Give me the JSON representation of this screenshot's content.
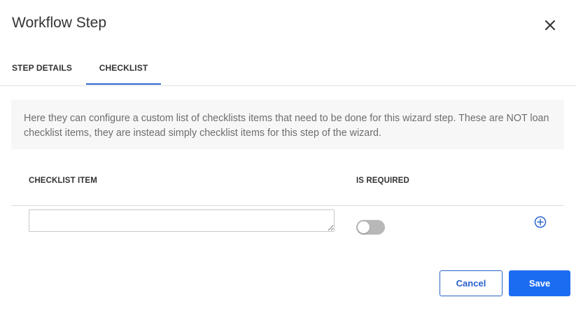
{
  "dialog": {
    "title": "Workflow Step"
  },
  "tabs": [
    {
      "label": "STEP DETAILS",
      "active": false
    },
    {
      "label": "CHECKLIST",
      "active": true
    }
  ],
  "info": {
    "text": "Here they can configure a custom list of checklists items that need to be done for this wizard step. These are NOT loan checklist items, they are instead simply checklist items for this step of the wizard."
  },
  "table": {
    "headers": {
      "item": "CHECKLIST ITEM",
      "required": "IS REQUIRED"
    },
    "rows": [
      {
        "item_value": "",
        "is_required": false
      }
    ]
  },
  "footer": {
    "cancel_label": "Cancel",
    "save_label": "Save"
  },
  "icons": {
    "close": "close-icon",
    "add": "plus-circle-icon"
  },
  "colors": {
    "accent": "#2f66cc",
    "primary_button": "#1c6cf2",
    "info_background": "#f7f7f7",
    "toggle_off": "#b8b8b8"
  }
}
